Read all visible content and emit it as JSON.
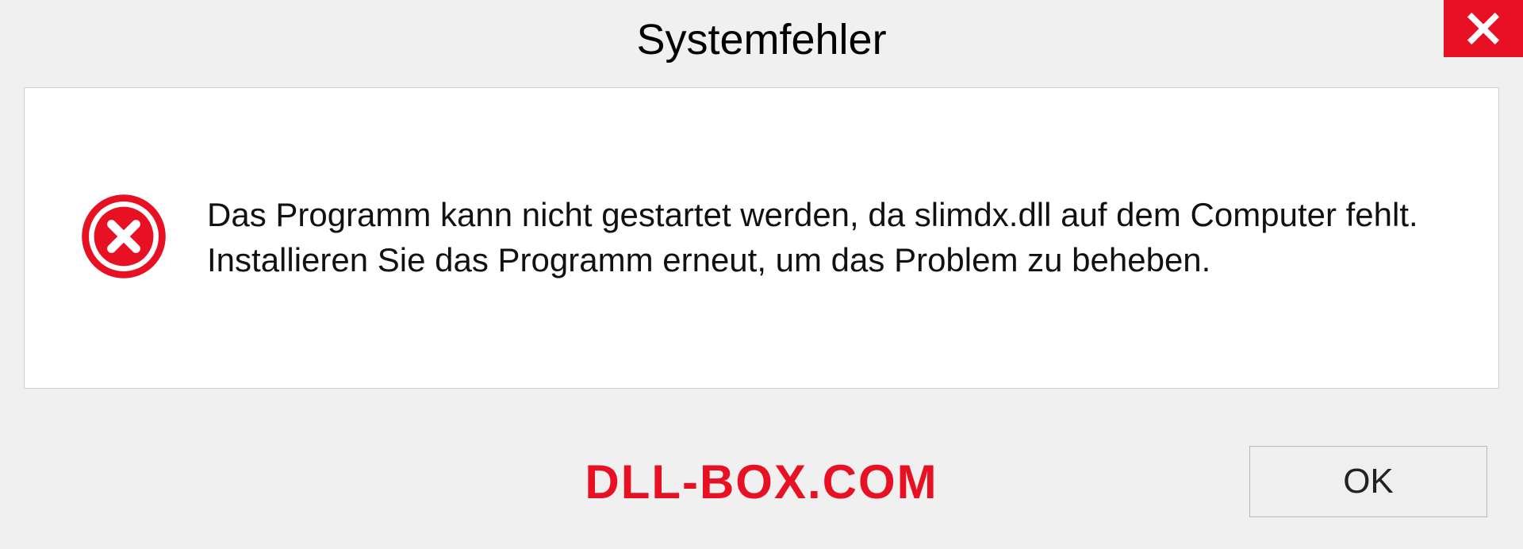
{
  "dialog": {
    "title": "Systemfehler",
    "message": "Das Programm kann nicht gestartet werden, da slimdx.dll auf dem Computer fehlt. Installieren Sie das Programm erneut, um das Problem zu beheben.",
    "ok_label": "OK"
  },
  "watermark": "DLL-BOX.COM"
}
